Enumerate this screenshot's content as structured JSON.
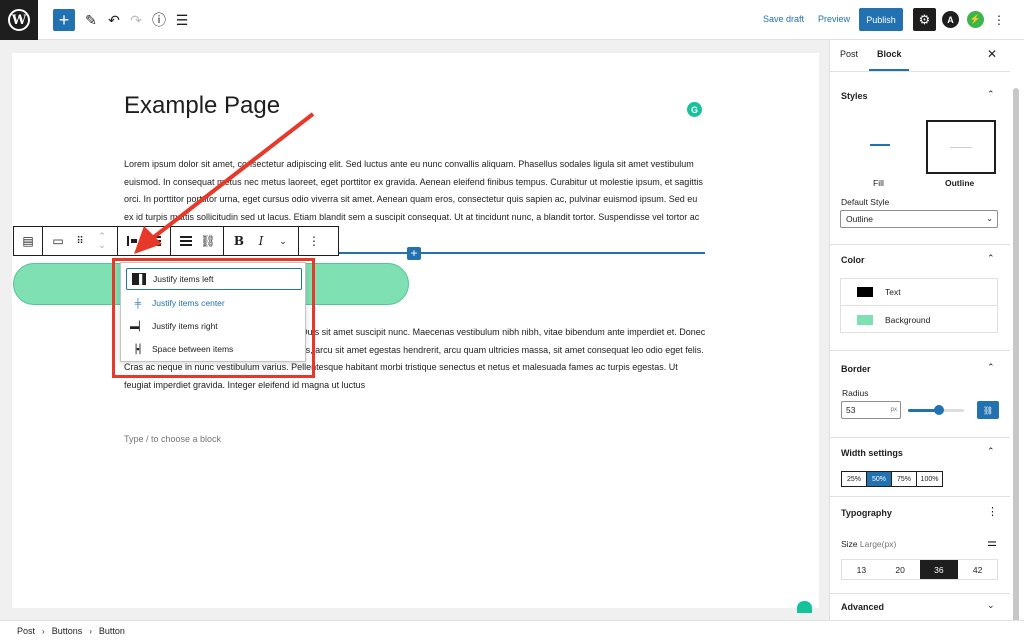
{
  "topbar": {
    "save_draft": "Save draft",
    "preview": "Preview",
    "publish": "Publish"
  },
  "editor": {
    "title": "Example Page",
    "paragraph1": "Lorem ipsum dolor sit amet, consectetur adipiscing elit. Sed luctus ante eu nunc convallis aliquam. Phasellus sodales ligula sit amet vestibulum euismod. In consequat metus nec metus laoreet, eget porttitor ex gravida. Aenean eleifend finibus tempus. Curabitur ut molestie ipsum, et sagittis orci. In porttitor porttitor urna, eget cursus odio viverra sit amet. Aenean quam eros, consectetur quis sapien ac, pulvinar euismod ipsum. Sed eu ex id turpis mattis sollicitudin sed ut lacus. Etiam blandit sem a suscipit consequat. Ut at tincidunt nunc, a blandit tortor. Suspendisse vel tortor ac ipsum. Maecenas vestibulum a velit eu mattis.",
    "paragraph2": "Proin sit amet orci id eros tincidunt rhoncus. Duis sit amet suscipit nunc. Maecenas vestibulum nibh nibh, vitae bibendum ante imperdiet et. Donec eleifend elit at ligula sagittis ultrices. In ultricies, arcu sit amet egestas hendrerit, arcu quam ultricies massa, sit amet consequat leo odio eget felis. Cras ac neque in nunc vestibulum varius. Pellentesque habitant morbi tristique senectus et netus et malesuada fames ac turpis egestas. Ut feugiat imperdiet gravida. Integer eleifend id magna ut luctus",
    "placeholder": "Type / to choose a block"
  },
  "justify_menu": {
    "items": [
      {
        "label": "Justify items left",
        "icon": "justify-left-icon"
      },
      {
        "label": "Justify items center",
        "icon": "justify-center-icon"
      },
      {
        "label": "Justify items right",
        "icon": "justify-right-icon"
      },
      {
        "label": "Space between items",
        "icon": "space-between-icon"
      }
    ],
    "selected": 0,
    "active": 1
  },
  "breadcrumb": [
    "Post",
    "Buttons",
    "Button"
  ],
  "sidebar": {
    "tabs": [
      "Post",
      "Block"
    ],
    "styles": {
      "title": "Styles",
      "options": [
        "Fill",
        "Outline"
      ],
      "default_style_label": "Default Style",
      "default_style_value": "Outline"
    },
    "color": {
      "title": "Color",
      "items": [
        {
          "label": "Text",
          "color": "#000000"
        },
        {
          "label": "Background",
          "color": "#7fe0b4"
        }
      ]
    },
    "border": {
      "title": "Border",
      "radius_label": "Radius",
      "radius_value": "53",
      "radius_unit": "px",
      "slider_fraction": 0.55
    },
    "width": {
      "title": "Width settings",
      "options": [
        "25%",
        "50%",
        "75%",
        "100%"
      ],
      "selected": "50%"
    },
    "typography": {
      "title": "Typography",
      "size_label": "Size",
      "size_value": "Large(px)",
      "sizes": [
        "13",
        "20",
        "36",
        "42"
      ],
      "selected": "36"
    },
    "advanced": {
      "title": "Advanced"
    }
  },
  "colors": {
    "accent": "#2271b1",
    "button_green": "#7fe0b4",
    "annotation_red": "#e8382a"
  }
}
